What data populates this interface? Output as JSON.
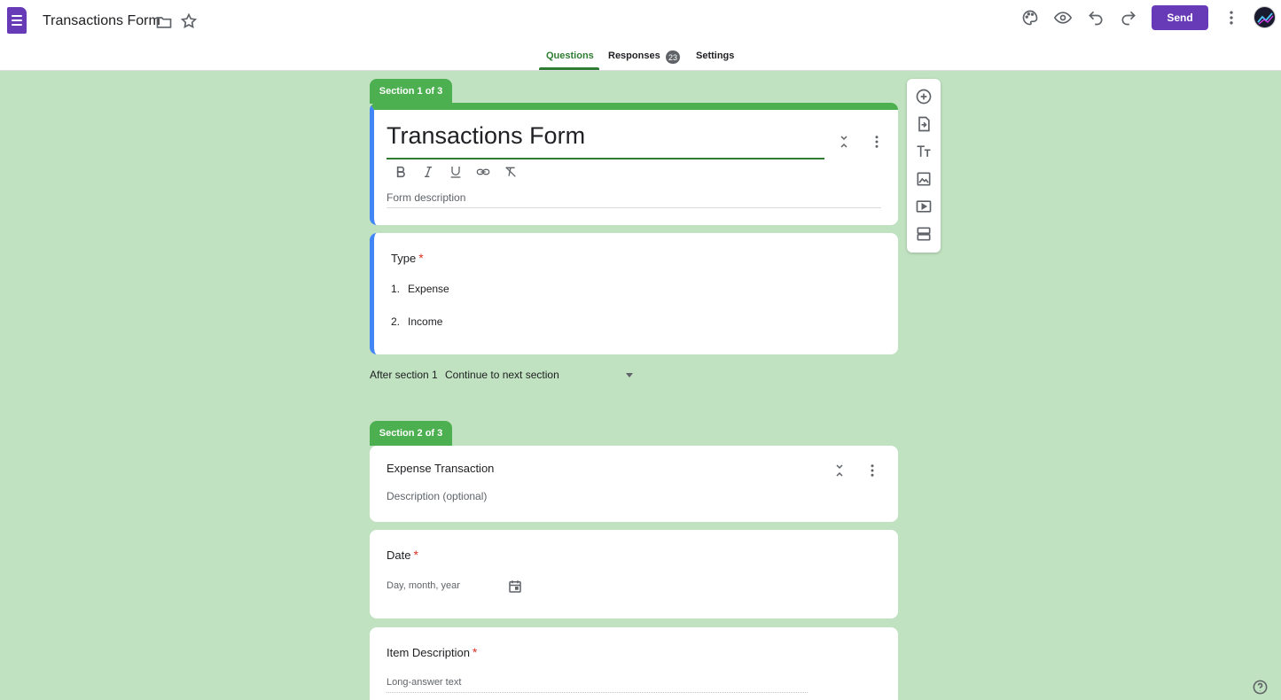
{
  "header": {
    "doc_title": "Transactions Form",
    "send_label": "Send",
    "tabs": [
      {
        "label": "Questions"
      },
      {
        "label": "Responses",
        "badge": "23"
      },
      {
        "label": "Settings"
      }
    ],
    "icons": [
      "folder-icon",
      "star-icon",
      "palette-icon",
      "preview-icon",
      "undo-icon",
      "redo-icon",
      "more-vert-icon"
    ]
  },
  "section1": {
    "tab_label": "Section 1 of 3",
    "title": "Transactions Form",
    "description_placeholder": "Form description",
    "question": {
      "title": "Type",
      "required": "*",
      "options": [
        {
          "num": "1.",
          "label": "Expense"
        },
        {
          "num": "2.",
          "label": "Income"
        }
      ]
    },
    "after_label": "After section 1",
    "after_value": "Continue to next section"
  },
  "section2": {
    "tab_label": "Section 2 of 3",
    "title": "Expense Transaction",
    "description_placeholder": "Description (optional)",
    "date_question": {
      "title": "Date",
      "required": "*",
      "placeholder": "Day, month, year"
    },
    "item_question": {
      "title": "Item Description",
      "required": "*",
      "placeholder": "Long-answer text"
    }
  },
  "colors": {
    "brand": "#673ab7",
    "accent": "#4caf50",
    "background": "#c0e2c0",
    "focus": "#4285f4"
  }
}
